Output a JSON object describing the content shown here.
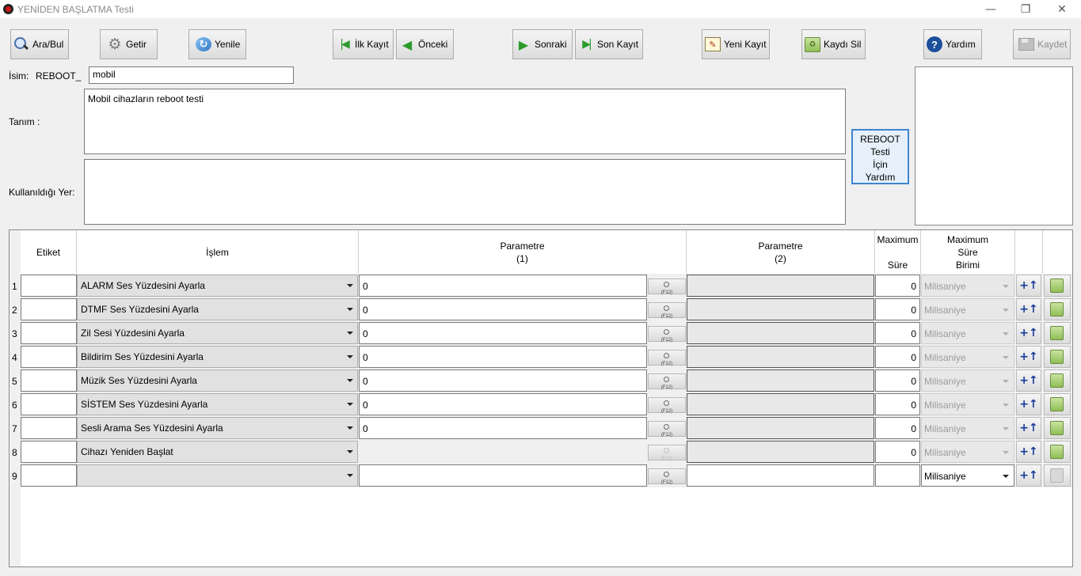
{
  "window": {
    "title": "YENİDEN BAŞLATMA Testi",
    "minimize": "—",
    "maximize": "❐",
    "close": "✕"
  },
  "toolbar": {
    "search": "Ara/Bul",
    "fetch": "Getir",
    "refresh": "Yenile",
    "first": "İlk Kayıt",
    "prev": "Önceki",
    "next": "Sonraki",
    "last": "Son Kayıt",
    "new": "Yeni Kayıt",
    "delete": "Kaydı Sil",
    "help": "Yardım",
    "save": "Kaydet"
  },
  "form": {
    "name_label": "İsim:",
    "name_prefix": "REBOOT_",
    "name_value": "mobil",
    "description_label": "Tanım :",
    "description_value": "Mobil cihazların reboot testi",
    "usage_label": "Kullanıldığı Yer:",
    "usage_value": "",
    "help_button": "REBOOT\nTesti\nİçin\nYardım"
  },
  "grid": {
    "headers": {
      "label": "Etiket",
      "operation": "İşlem",
      "param1": "Parametre\n(1)",
      "param2": "Parametre\n(2)",
      "max_duration": "Maximum\n\nSüre",
      "max_duration_unit": "Maximum\nSüre\nBirimi"
    },
    "f12": "(F12)",
    "up_symbol": "+↑",
    "rows": [
      {
        "num": "1",
        "label": "",
        "operation": "ALARM Ses Yüzdesini Ayarla",
        "param1": "0",
        "max": "0",
        "unit": "Milisaniye"
      },
      {
        "num": "2",
        "label": "",
        "operation": "DTMF Ses Yüzdesini Ayarla",
        "param1": "0",
        "max": "0",
        "unit": "Milisaniye"
      },
      {
        "num": "3",
        "label": "",
        "operation": "Zil Sesi Yüzdesini Ayarla",
        "param1": "0",
        "max": "0",
        "unit": "Milisaniye"
      },
      {
        "num": "4",
        "label": "",
        "operation": "Bildirim Ses Yüzdesini Ayarla",
        "param1": "0",
        "max": "0",
        "unit": "Milisaniye"
      },
      {
        "num": "5",
        "label": "",
        "operation": "Müzik Ses Yüzdesini Ayarla",
        "param1": "0",
        "max": "0",
        "unit": "Milisaniye"
      },
      {
        "num": "6",
        "label": "",
        "operation": "SİSTEM Ses Yüzdesini Ayarla",
        "param1": "0",
        "max": "0",
        "unit": "Milisaniye"
      },
      {
        "num": "7",
        "label": "",
        "operation": "Sesli Arama Ses Yüzdesini Ayarla",
        "param1": "0",
        "max": "0",
        "unit": "Milisaniye"
      },
      {
        "num": "8",
        "label": "",
        "operation": "Cihazı Yeniden Başlat",
        "param1": "",
        "max": "0",
        "unit": "Milisaniye"
      },
      {
        "num": "9",
        "label": "",
        "operation": "",
        "param1": "",
        "max": "",
        "unit": "Milisaniye"
      }
    ]
  }
}
